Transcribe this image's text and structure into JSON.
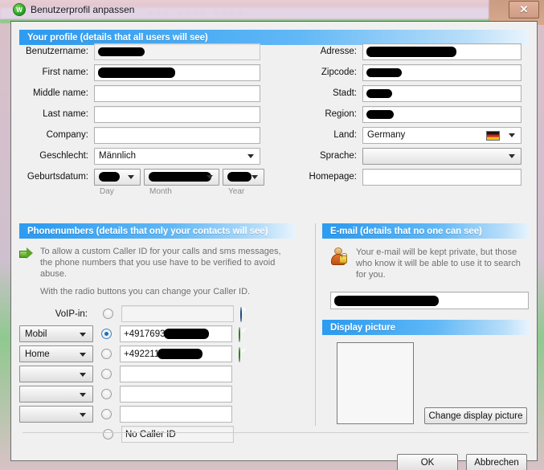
{
  "window": {
    "title": "Benutzerprofil anpassen",
    "app_icon_letter": "W",
    "close_label": "✕"
  },
  "background_window": {
    "blurred_menu_text": "··· ···· ····"
  },
  "profile_section": {
    "header": "Your profile (details that all users will see)",
    "left_fields": [
      {
        "label": "Benutzername:",
        "value": "",
        "type": "text",
        "readonly": true,
        "redacted": true,
        "redact_width": 58
      },
      {
        "label": "First name:",
        "value": "",
        "type": "text",
        "readonly": false,
        "redacted": true,
        "redact_width": 96
      },
      {
        "label": "Middle name:",
        "value": "",
        "type": "text",
        "readonly": false,
        "redacted": false,
        "redact_width": 0
      },
      {
        "label": "Last name:",
        "value": "",
        "type": "text",
        "readonly": false,
        "redacted": false,
        "redact_width": 0
      },
      {
        "label": "Company:",
        "value": "",
        "type": "text",
        "readonly": false,
        "redacted": false,
        "redact_width": 0
      }
    ],
    "gender": {
      "label": "Geschlecht:",
      "value": "Männlich"
    },
    "birthdate": {
      "label": "Geburtsdatum:",
      "day": {
        "value": "",
        "redacted": true,
        "redact_width": 26,
        "sublabel": "Day"
      },
      "month": {
        "value": "",
        "redacted": true,
        "redact_width": 78,
        "sublabel": "Month"
      },
      "year": {
        "value": "",
        "redacted": true,
        "redact_width": 30,
        "sublabel": "Year"
      }
    },
    "right_fields": [
      {
        "label": "Adresse:",
        "value": "",
        "type": "text",
        "readonly": false,
        "redacted": true,
        "redact_width": 112
      },
      {
        "label": "Zipcode:",
        "value": "",
        "type": "text",
        "readonly": false,
        "redacted": true,
        "redact_width": 44
      },
      {
        "label": "Stadt:",
        "value": "",
        "type": "text",
        "readonly": false,
        "redacted": true,
        "redact_width": 32
      },
      {
        "label": "Region:",
        "value": "",
        "type": "text",
        "readonly": false,
        "redacted": true,
        "redact_width": 34
      }
    ],
    "country": {
      "label": "Land:",
      "value": "Germany",
      "flag": "de-flag-icon"
    },
    "language": {
      "label": "Sprache:",
      "value": ""
    },
    "homepage": {
      "label": "Homepage:",
      "value": ""
    }
  },
  "phone_section": {
    "header": "Phonenumbers (details that only your contacts will see)",
    "info_line_1": "To allow a custom Caller ID for your calls and sms messages, the phone numbers that you use have to be verified to avoid abuse.",
    "info_line_2": "With the radio buttons you can change your Caller ID.",
    "arrow_icon": "green-arrow-icon",
    "voip_label": "VoIP-in:",
    "rows": [
      {
        "type": "",
        "has_type_combo": false,
        "selected": false,
        "value": "",
        "value_redacted": false,
        "redact_width": 0,
        "input_grey": true,
        "status": "help"
      },
      {
        "type": "Mobil",
        "has_type_combo": true,
        "selected": true,
        "value": "+4917693",
        "value_redacted": true,
        "redact_width": 56,
        "input_grey": false,
        "status": "verified"
      },
      {
        "type": "Home",
        "has_type_combo": true,
        "selected": false,
        "value": "+492211",
        "value_redacted": true,
        "redact_width": 56,
        "input_grey": false,
        "status": "verified"
      },
      {
        "type": "",
        "has_type_combo": true,
        "selected": false,
        "value": "",
        "value_redacted": false,
        "redact_width": 0,
        "input_grey": false,
        "status": "none"
      },
      {
        "type": "",
        "has_type_combo": true,
        "selected": false,
        "value": "",
        "value_redacted": false,
        "redact_width": 0,
        "input_grey": false,
        "status": "none"
      },
      {
        "type": "",
        "has_type_combo": true,
        "selected": false,
        "value": "",
        "value_redacted": false,
        "redact_width": 0,
        "input_grey": false,
        "status": "none"
      },
      {
        "type": "",
        "has_type_combo": false,
        "selected": false,
        "value": "No Caller ID",
        "value_redacted": false,
        "redact_width": 0,
        "input_grey": true,
        "status": "none"
      }
    ]
  },
  "email_section": {
    "header": "E-mail (details that no one can see)",
    "icon": "user-lock-icon",
    "info": "Your e-mail will be kept private, but those who know it will be able to use it to search for you.",
    "value": "",
    "value_redacted": true,
    "redact_width": 130
  },
  "display_picture_section": {
    "header": "Display picture",
    "change_button": "Change display picture"
  },
  "footer": {
    "ok_label": "OK",
    "cancel_label": "Abbrechen"
  },
  "colors": {
    "section_header_start": "#2e9cf0",
    "section_header_end": "#e9f4fd",
    "dialog_bg": "#f0f0f0",
    "accent_green": "#2f9b22",
    "accent_blue": "#1e6db5"
  }
}
